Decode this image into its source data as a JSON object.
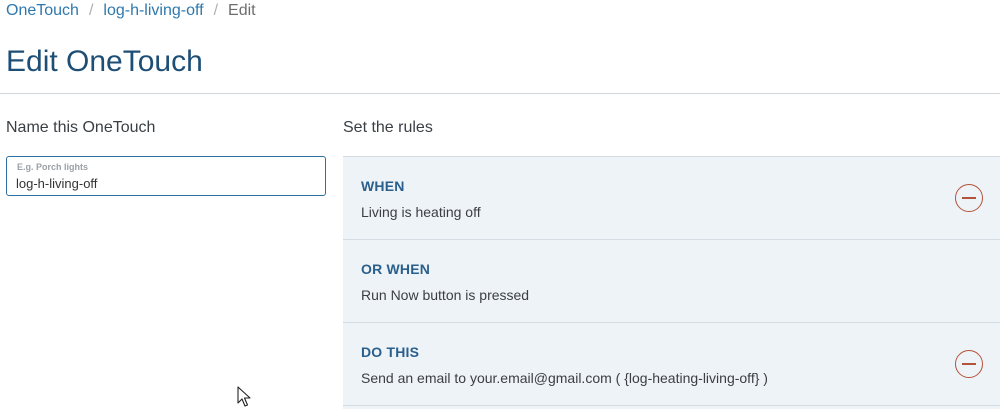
{
  "breadcrumb": {
    "items": [
      "OneTouch",
      "log-h-living-off"
    ],
    "current": "Edit",
    "separator": "/"
  },
  "page": {
    "title": "Edit OneTouch"
  },
  "name_section": {
    "heading": "Name this OneTouch",
    "field_label": "E.g. Porch lights",
    "field_value": "log-h-living-off"
  },
  "rules_section": {
    "heading": "Set the rules",
    "rules": [
      {
        "label": "WHEN",
        "text": "Living is heating off",
        "removable": true
      },
      {
        "label": "OR WHEN",
        "text": "Run Now button is pressed",
        "removable": false
      },
      {
        "label": "DO THIS",
        "text": "Send an email to your.email@gmail.com ( {log-heating-living-off} )",
        "removable": true
      }
    ]
  },
  "icons": {
    "remove": "minus-circle-icon",
    "cursor": "mouse-pointer-icon"
  },
  "colors": {
    "link": "#2f78ad",
    "title": "#1d4e76",
    "rule_label": "#2a5f8c",
    "remove": "#b5533a",
    "panel_bg": "#eef3f7"
  }
}
